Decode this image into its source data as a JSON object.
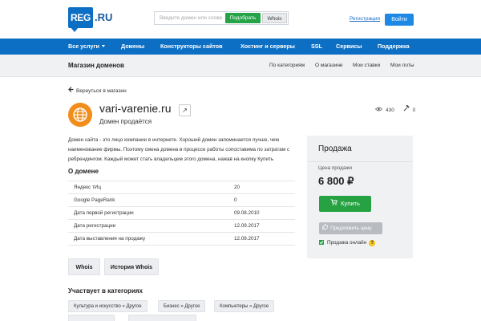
{
  "header": {
    "logo_text": "REG",
    "logo_suffix": ".RU",
    "search_placeholder": "Введите домен или слово",
    "find_button": "Подобрать",
    "whois_button": "Whois",
    "register_link": "Регистрация",
    "login_button": "Войти"
  },
  "nav": {
    "items": [
      "Все услуги",
      "Домены",
      "Конструкторы сайтов",
      "Хостинг и серверы",
      "SSL",
      "Сервисы",
      "Поддержка"
    ]
  },
  "subnav": {
    "title": "Магазин доменов",
    "links": [
      "По категориям",
      "О магазине",
      "Мои ставки",
      "Мои лоты"
    ]
  },
  "page": {
    "back_link": "Вернуться в магазин",
    "domain_name": "vari-varenie.ru",
    "domain_status": "Домен продаётся",
    "views_count": "430",
    "bids_count": "0",
    "description": "Домен сайта - это лицо компании в интернете. Хороший домен запоминается лучше, чем наименование фирмы. Поэтому смена домена в процессе работы сопоставима по затратам с ребрендингом. Каждый может стать владельцем этого домена, нажав на кнопку Купить",
    "about_title": "О домене",
    "about_rows": [
      {
        "key": "Яндекс тИц",
        "value": "20"
      },
      {
        "key": "Google PageRank",
        "value": "0"
      },
      {
        "key": "Дата первой регистрации",
        "value": "09.08.2010"
      },
      {
        "key": "Дата регистрации",
        "value": "12.09.2017"
      },
      {
        "key": "Дата выставления на продажу",
        "value": "12.09.2017"
      }
    ],
    "tab_whois": "Whois",
    "tab_history": "История Whois",
    "categories_title": "Участвует в категориях",
    "categories": [
      "Культура и искусство » Другое",
      "Бизнес » Другое",
      "Компьютеры » Другое"
    ],
    "categories_row2": [
      "",
      ""
    ]
  },
  "sale": {
    "title": "Продажа",
    "price_label": "Цена продажи",
    "price": "6 800 ₽",
    "buy_button": "Купить",
    "offer_button": "Предложить цену",
    "online_label": "Продажа онлайн",
    "help_mark": "?"
  },
  "colors": {
    "brand_blue": "#0d6fc4",
    "green": "#27a243",
    "icon_orange": "#f28c1a"
  }
}
